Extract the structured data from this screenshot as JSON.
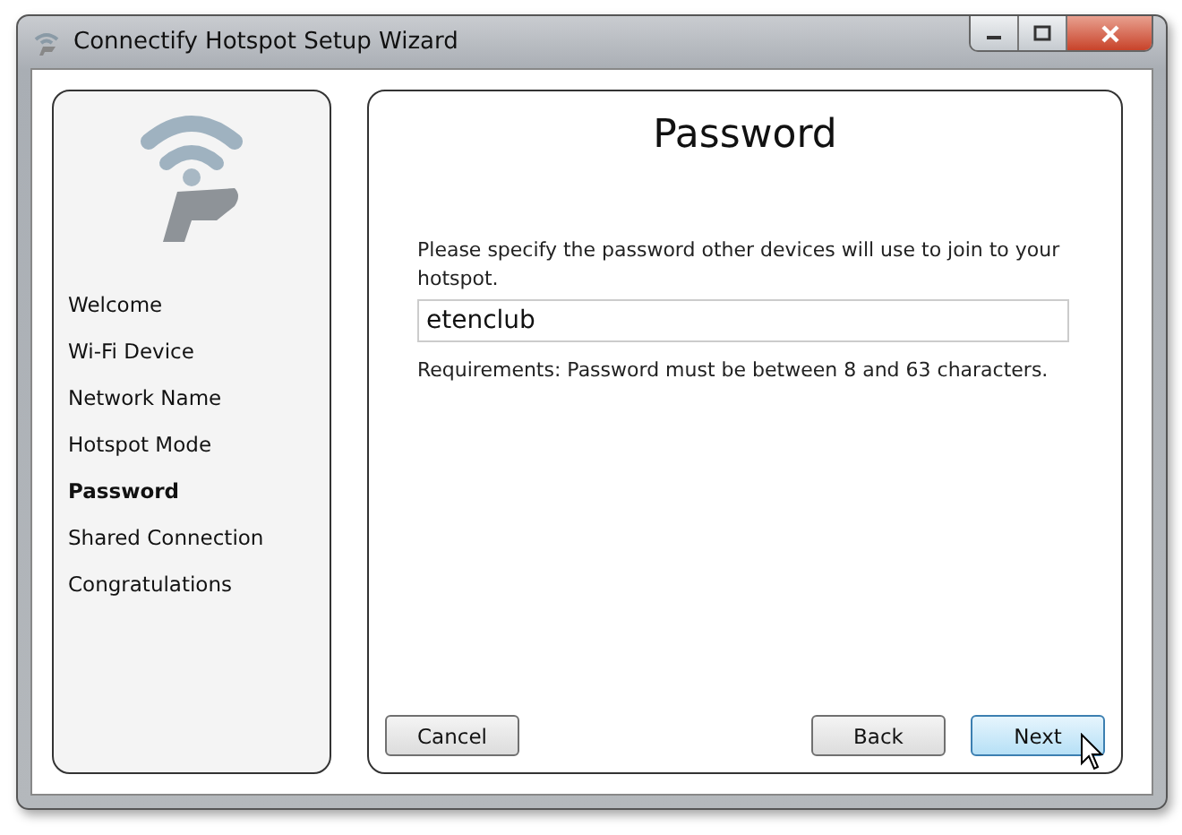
{
  "window": {
    "title": "Connectify Hotspot Setup Wizard"
  },
  "sidebar": {
    "items": [
      {
        "label": "Welcome",
        "selected": false
      },
      {
        "label": "Wi-Fi Device",
        "selected": false
      },
      {
        "label": "Network Name",
        "selected": false
      },
      {
        "label": "Hotspot Mode",
        "selected": false
      },
      {
        "label": "Password",
        "selected": true
      },
      {
        "label": "Shared Connection",
        "selected": false
      },
      {
        "label": "Congratulations",
        "selected": false
      }
    ]
  },
  "page": {
    "title": "Password",
    "instruction": "Please specify the password other devices will use to join to your hotspot.",
    "password_value": "etenclub",
    "requirements": "Requirements: Password must be between 8 and 63 characters."
  },
  "buttons": [
    {
      "label": "Cancel",
      "highlighted": false
    },
    {
      "label": "Back",
      "highlighted": false
    },
    {
      "label": "Next",
      "highlighted": true
    }
  ]
}
